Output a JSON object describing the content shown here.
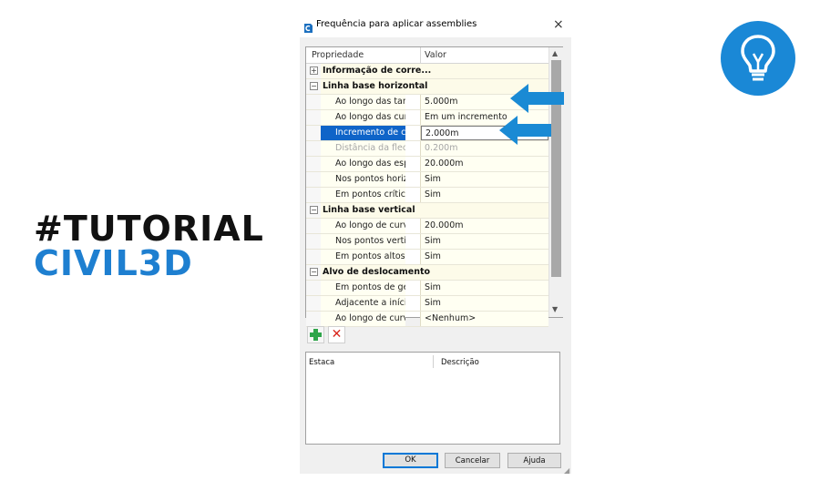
{
  "branding": {
    "line1": "#TUTORIAL",
    "line2": "CIVIL3D",
    "accent_color": "#1e7fd0",
    "bulb_icon": "lightbulb-icon"
  },
  "dialog": {
    "title": "Frequência para aplicar assemblies",
    "close_label": "×",
    "grid": {
      "header_property": "Propriedade",
      "header_value": "Valor",
      "rows": [
        {
          "type": "category",
          "label": "Informação de corre...",
          "toggle": "+"
        },
        {
          "type": "category",
          "label": "Linha base horizontal",
          "toggle": "−"
        },
        {
          "type": "prop",
          "label": "Ao longo das tang...",
          "value": "5.000m"
        },
        {
          "type": "prop",
          "label": "Ao longo das curvas",
          "value": "Em um incremento"
        },
        {
          "type": "prop",
          "label": "Incremento de curva",
          "value": "2.000m",
          "selected": true
        },
        {
          "type": "prop",
          "label": "Distância da flecha...",
          "value": "0.200m",
          "disabled": true
        },
        {
          "type": "prop",
          "label": "Ao longo das espir...",
          "value": "20.000m"
        },
        {
          "type": "prop",
          "label": "Nos pontos horizo...",
          "value": "Sim"
        },
        {
          "type": "prop",
          "label": "Em pontos críticos ...",
          "value": "Sim"
        },
        {
          "type": "category",
          "label": "Linha base vertical",
          "toggle": "−"
        },
        {
          "type": "prop",
          "label": "Ao longo de curvas...",
          "value": "20.000m"
        },
        {
          "type": "prop",
          "label": "Nos pontos verticai...",
          "value": "Sim"
        },
        {
          "type": "prop",
          "label": "Em pontos altos ou...",
          "value": "Sim"
        },
        {
          "type": "category",
          "label": "Alvo de deslocamento",
          "toggle": "−"
        },
        {
          "type": "prop",
          "label": "Em pontos de geo...",
          "value": "Sim"
        },
        {
          "type": "prop",
          "label": "Adjacente a início/...",
          "value": "Sim"
        },
        {
          "type": "prop",
          "label": "Ao longo de curvas...",
          "value": "<Nenhum>"
        }
      ]
    },
    "list": {
      "col_station": "Estaca",
      "col_description": "Descrição"
    },
    "buttons": {
      "ok": "OK",
      "cancel": "Cancelar",
      "help": "Ajuda"
    },
    "arrow_color": "#1a8ad4"
  }
}
